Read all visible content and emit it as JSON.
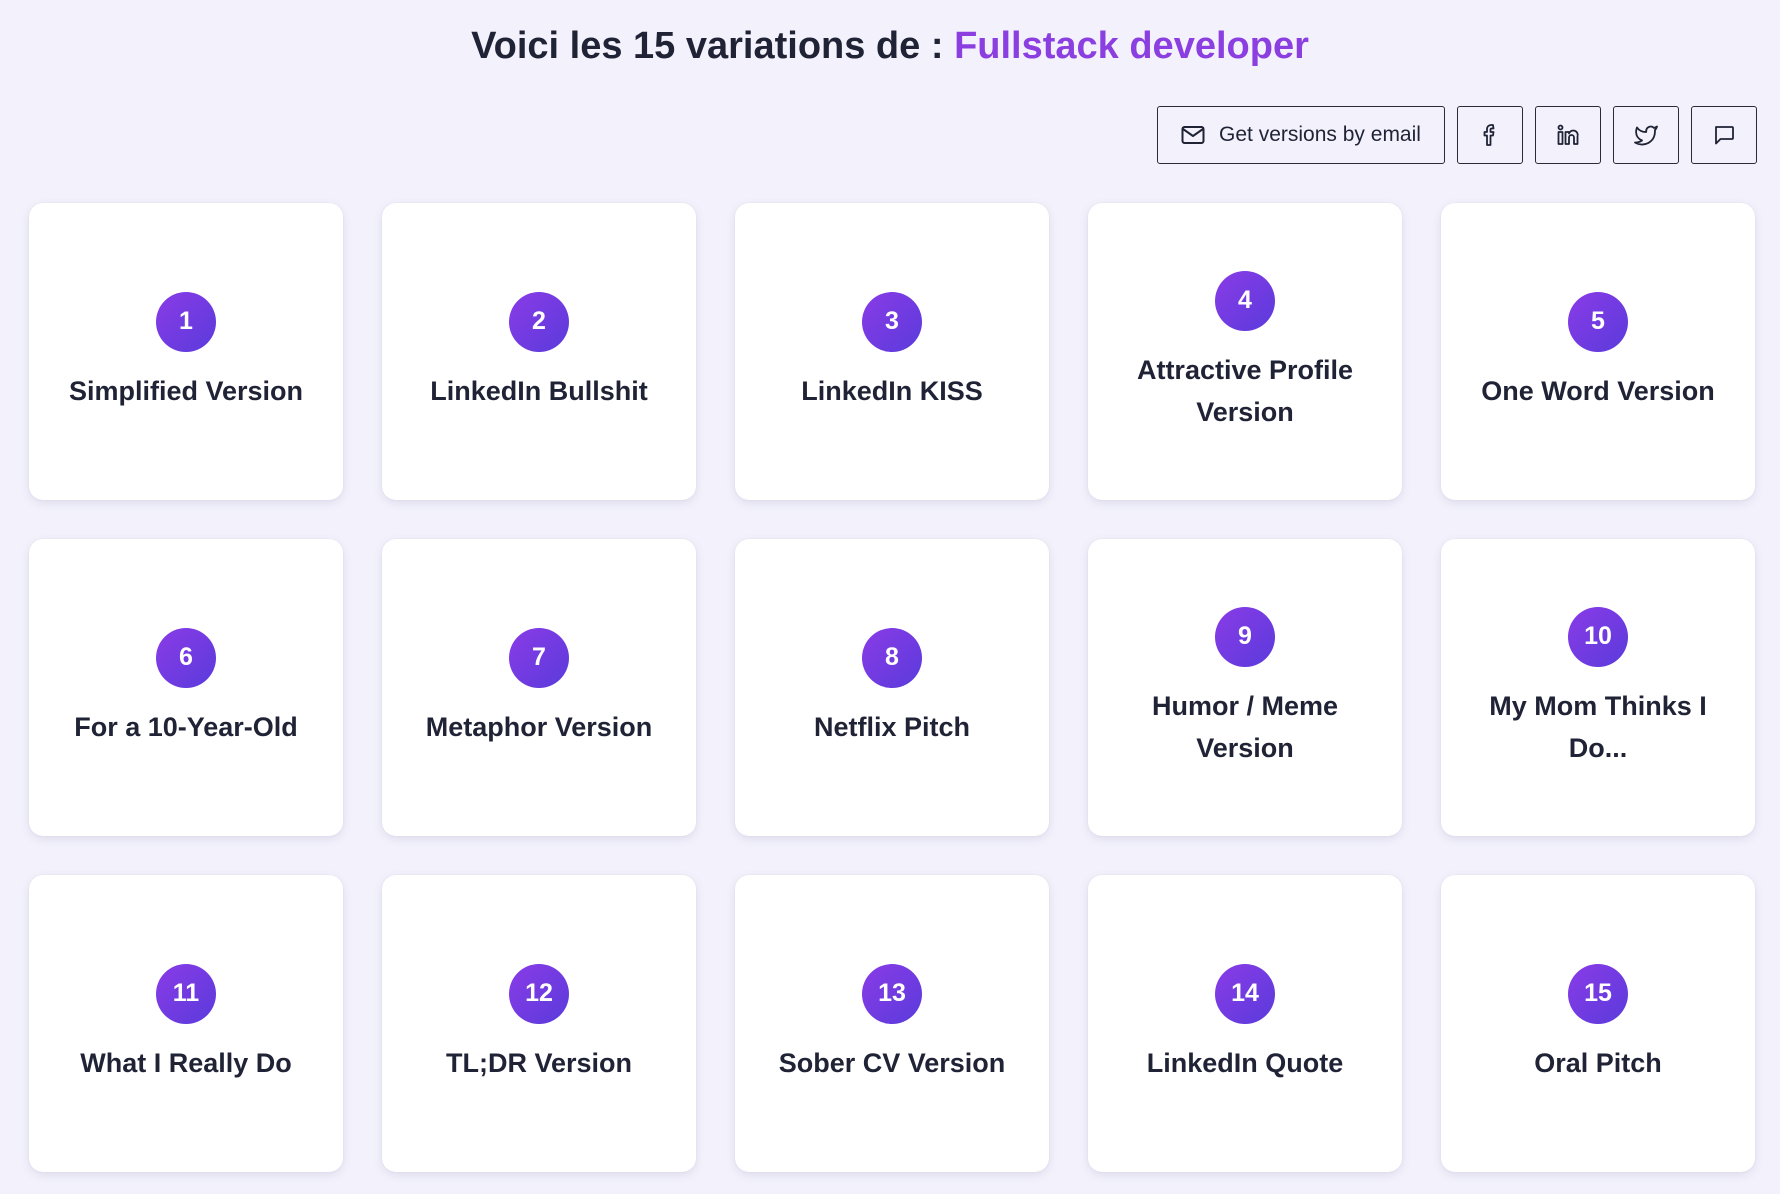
{
  "header": {
    "title_prefix": "Voici les 15 variations de : ",
    "title_highlight": "Fullstack developer"
  },
  "actions": {
    "email_label": "Get versions by email",
    "email_icon": "mail-icon",
    "share_icons": [
      "facebook-icon",
      "linkedin-icon",
      "twitter-icon",
      "message-icon"
    ]
  },
  "colors": {
    "accent": "#8b3fe0",
    "badge_start": "#8a3be6",
    "badge_end": "#5a3bdc",
    "background": "#f3f2fc",
    "card": "#ffffff"
  },
  "cards": [
    {
      "number": "1",
      "label": "Simplified Version"
    },
    {
      "number": "2",
      "label": "LinkedIn Bullshit"
    },
    {
      "number": "3",
      "label": "LinkedIn KISS"
    },
    {
      "number": "4",
      "label": "Attractive Profile Version"
    },
    {
      "number": "5",
      "label": "One Word Version"
    },
    {
      "number": "6",
      "label": "For a 10-Year-Old"
    },
    {
      "number": "7",
      "label": "Metaphor Version"
    },
    {
      "number": "8",
      "label": "Netflix Pitch"
    },
    {
      "number": "9",
      "label": "Humor / Meme Version"
    },
    {
      "number": "10",
      "label": "My Mom Thinks I Do..."
    },
    {
      "number": "11",
      "label": "What I Really Do"
    },
    {
      "number": "12",
      "label": "TL;DR Version"
    },
    {
      "number": "13",
      "label": "Sober CV Version"
    },
    {
      "number": "14",
      "label": "LinkedIn Quote"
    },
    {
      "number": "15",
      "label": "Oral Pitch"
    }
  ]
}
